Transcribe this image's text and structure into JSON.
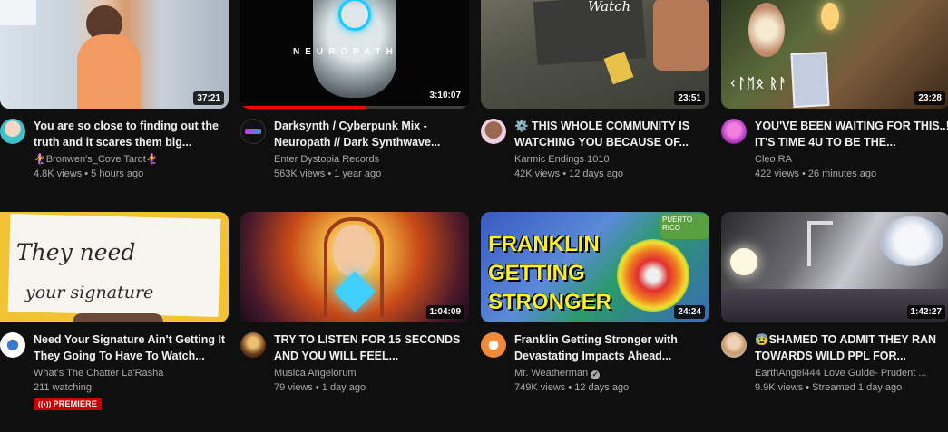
{
  "videos": [
    {
      "title": "You are so close to finding out the truth and it scares them big...",
      "channel": "🧜‍♀️Bronwen's_Cove Tarot🧜‍♀️",
      "views": "4.8K views",
      "age": "5 hours ago",
      "duration": "37:21"
    },
    {
      "title": "Darksynth / Cyberpunk Mix - Neuropath // Dark Synthwave...",
      "channel": "Enter Dystopia Records",
      "views": "563K views",
      "age": "1 year ago",
      "duration": "3:10:07",
      "thumb_text": "NEUROPATH",
      "progress_percent": 55
    },
    {
      "title": "⚙️ THIS WHOLE COMMUNITY IS WATCHING YOU BECAUSE OF...",
      "channel": "Karmic Endings 1010",
      "views": "42K views",
      "age": "12 days ago",
      "duration": "23:51",
      "thumb_text": "Watch"
    },
    {
      "title": "YOU'VE BEEN WAITING FOR THIS..! IT'S TIME 4U TO BE THE...",
      "channel": "Cleo RA",
      "views": "422 views",
      "age": "26 minutes ago",
      "duration": "23:28",
      "thumb_text": "ᚲᛚᛖᛟ ᚱᚨ"
    },
    {
      "title": "Need Your Signature Ain't Getting It They Going To Have To Watch...",
      "channel": "What's The Chatter La'Rasha",
      "stats_line": "211 watching",
      "badge": "PREMIERE",
      "thumb_line1": "They need",
      "thumb_line2": "your signature"
    },
    {
      "title": "TRY TO LISTEN FOR 15 SECONDS AND YOU WILL FEEL...",
      "channel": "Musica Angelorum",
      "views": "79 views",
      "age": "1 day ago",
      "duration": "1:04:09"
    },
    {
      "title": "Franklin Getting Stronger with Devastating Impacts Ahead...",
      "channel": "Mr. Weatherman",
      "views": "749K views",
      "age": "12 days ago",
      "duration": "24:24",
      "thumb_lines": [
        "FRANKLIN",
        "GETTING",
        "STRONGER"
      ],
      "thumb_label": "PUERTO RICO"
    },
    {
      "title": "😰SHAMED TO ADMIT THEY RAN TOWARDS WILD PPL FOR...",
      "channel": "EarthAngel444 Love Guide- Prudent ...",
      "views": "9.9K views",
      "age": "Streamed 1 day ago",
      "duration": "1:42:27"
    }
  ],
  "separator": " • ",
  "colors": {
    "accent_red": "#ff0000",
    "badge_red": "#cc0000",
    "meta_gray": "#aaaaaa"
  }
}
